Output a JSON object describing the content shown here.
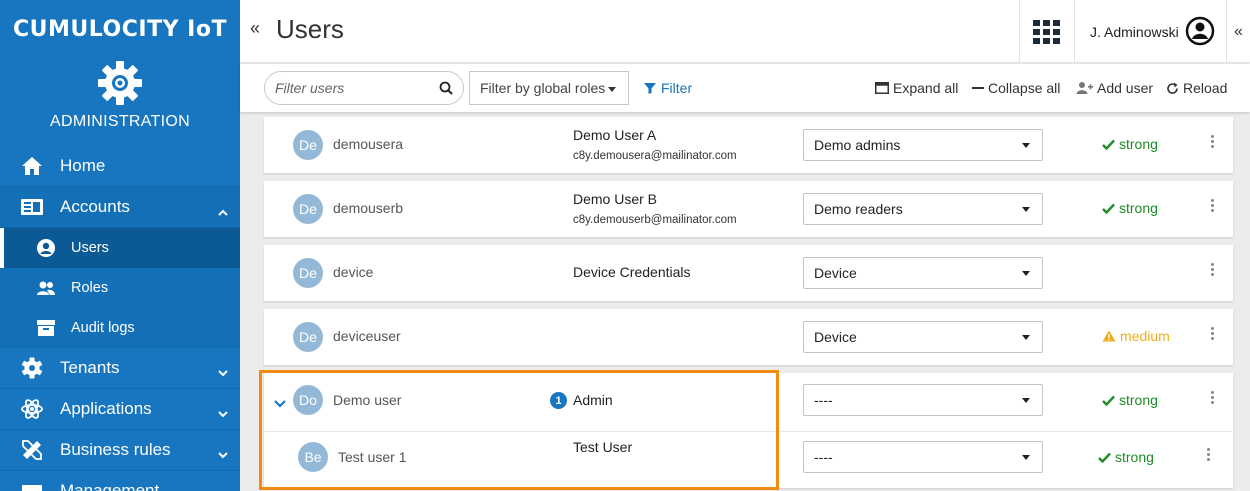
{
  "brand": {
    "name": "CUMULOCITY IoT",
    "app_name": "ADMINISTRATION"
  },
  "sidebar": {
    "items": [
      {
        "label": "Home",
        "icon": "home-icon"
      },
      {
        "label": "Accounts",
        "icon": "accounts-icon",
        "expanded": true,
        "children": [
          {
            "label": "Users",
            "icon": "user-circle-icon",
            "active": true
          },
          {
            "label": "Roles",
            "icon": "roles-icon"
          },
          {
            "label": "Audit logs",
            "icon": "archive-icon"
          }
        ]
      },
      {
        "label": "Tenants",
        "icon": "gear-icon"
      },
      {
        "label": "Applications",
        "icon": "atom-icon"
      },
      {
        "label": "Business rules",
        "icon": "ruler-pencil-icon"
      },
      {
        "label": "Management",
        "icon": "management-icon"
      }
    ]
  },
  "header": {
    "collapse_label": "«",
    "title": "Users",
    "user_name": "J. Adminowski",
    "right_collapse_label": "«"
  },
  "toolbar": {
    "search_placeholder": "Filter users",
    "role_filter_label": "Filter by global roles",
    "filter_label": "Filter",
    "expand_all": "Expand all",
    "collapse_all": "Collapse all",
    "add_user": "Add user",
    "reload": "Reload"
  },
  "users": [
    {
      "initials": "De",
      "username": "demousera",
      "fullname": "Demo User A",
      "email": "c8y.demousera@mailinator.com",
      "group": "Demo admins",
      "strength": "strong"
    },
    {
      "initials": "De",
      "username": "demouserb",
      "fullname": "Demo User B",
      "email": "c8y.demouserb@mailinator.com",
      "group": "Demo readers",
      "strength": "strong"
    },
    {
      "initials": "De",
      "username": "device",
      "fullname": "Device Credentials",
      "email": "",
      "group": "Device",
      "strength": ""
    },
    {
      "initials": "De",
      "username": "deviceuser",
      "fullname": "",
      "email": "",
      "group": "Device",
      "strength": "medium"
    }
  ],
  "expanded_user": {
    "initials": "Do",
    "username": "Demo user",
    "badge_count": "1",
    "role_label": "Admin",
    "group": "----",
    "strength": "strong",
    "sub_user": {
      "initials": "Be",
      "username": "Test user 1",
      "fullname": "Test User",
      "group": "----",
      "strength": "strong"
    }
  },
  "colors": {
    "sidebar": "#1776bf",
    "accent": "#1776bf",
    "strong": "#1e8a28",
    "medium": "#f0ad1c",
    "highlight": "#f28c10"
  }
}
